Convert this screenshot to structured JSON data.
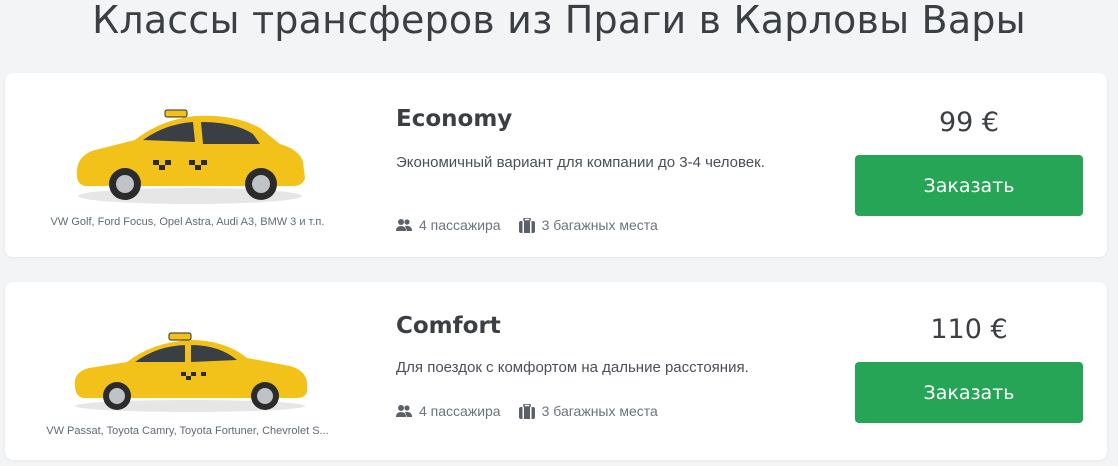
{
  "page": {
    "title": "Классы трансферов из Праги в Карловы Вары"
  },
  "colors": {
    "accent": "#27a556",
    "taxi_yellow": "#f2c21b"
  },
  "classes": [
    {
      "name": "Economy",
      "models": "VW Golf, Ford Focus, Opel Astra, Audi A3, BMW 3 и т.п.",
      "description": "Экономичный вариант для компании до 3-4 человек.",
      "passengers": "4 пассажира",
      "luggage": "3 багажных места",
      "price": "99 €",
      "button": "Заказать",
      "image_icon": "hatchback-taxi-image"
    },
    {
      "name": "Comfort",
      "models": "VW Passat, Toyota Camry, Toyota Fortuner, Chevrolet S...",
      "description": "Для поездок с комфортом на дальние расстояния.",
      "passengers": "4 пассажира",
      "luggage": "3 багажных места",
      "price": "110 €",
      "button": "Заказать",
      "image_icon": "sedan-taxi-image"
    }
  ]
}
